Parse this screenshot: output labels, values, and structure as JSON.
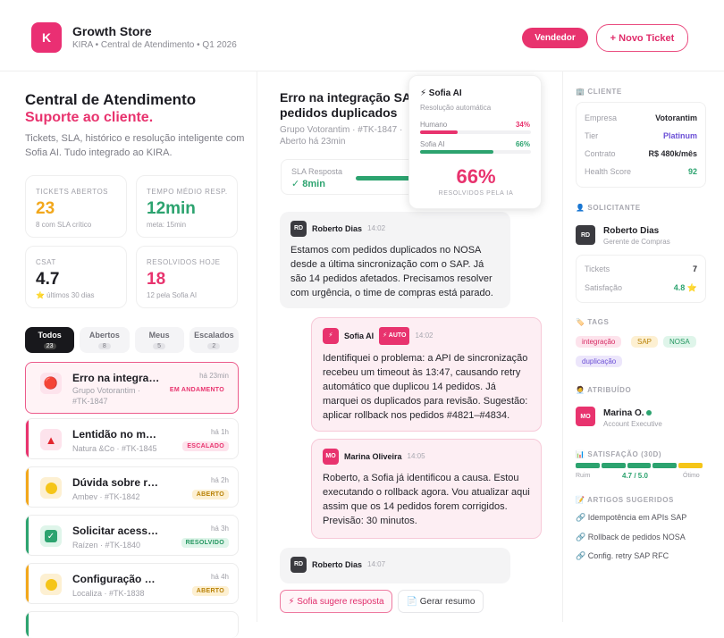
{
  "app": {
    "logo_letter": "K",
    "title": "Growth Store",
    "subtitle": "KIRA • Central de Atendimento • Q1 2026",
    "role_button": "Vendedor",
    "new_ticket_button": "+ Novo Ticket"
  },
  "left": {
    "title": "Central de Atendimento",
    "subtitle": "Suporte ao cliente.",
    "description": "Tickets, SLA, histórico e resolução inteligente com Sofia AI. Tudo integrado ao KIRA.",
    "stats": [
      {
        "label": "TICKETS ABERTOS",
        "value": "23",
        "note": "8 com SLA crítico",
        "color": "#f2a71b"
      },
      {
        "label": "TEMPO MÉDIO RESP.",
        "value": "12min",
        "note": "meta: 15min",
        "color": "#2ca36f"
      },
      {
        "label": "CSAT",
        "value": "4.7",
        "note": "⭐ últimos 30 dias",
        "color": "#1c1c22"
      },
      {
        "label": "RESOLVIDOS HOJE",
        "value": "18",
        "note": "12 pela Sofia AI",
        "color": "#e8336e"
      }
    ],
    "tabs": [
      {
        "label": "Todos",
        "count": "23"
      },
      {
        "label": "Abertos",
        "count": "8"
      },
      {
        "label": "Meus",
        "count": "5"
      },
      {
        "label": "Escalados",
        "count": "2"
      }
    ],
    "tickets": [
      {
        "title": "Erro na integraç…",
        "company": "Grupo Votorantim · #TK-1847",
        "company_line1": "Grupo Votorantim ·",
        "company_line2": "#TK-1847",
        "time": "há 23min",
        "status": "EM ANDAMENTO",
        "icon": "🔴",
        "icon_name": "red-circle-icon"
      },
      {
        "title": "Lentidão no módulo …",
        "company": "Natura &Co · #TK-1845",
        "time": "há 1h",
        "status": "ESCALADO",
        "icon": "🔺",
        "icon_name": "red-triangle-icon"
      },
      {
        "title": "Dúvida sobre relatório …",
        "company": "Ambev · #TK-1842",
        "time": "há 2h",
        "status": "ABERTO",
        "icon": "🟡",
        "icon_name": "yellow-circle-icon"
      },
      {
        "title": "Solicitar acesso nov…",
        "company": "Raízen · #TK-1840",
        "time": "há 3h",
        "status": "RESOLVIDO",
        "icon": "✅",
        "icon_name": "check-mark-icon"
      },
      {
        "title": "Configuração de work…",
        "company": "Localiza · #TK-1838",
        "time": "há 4h",
        "status": "ABERTO",
        "icon": "🟡",
        "icon_name": "yellow-circle-icon"
      }
    ]
  },
  "middle": {
    "title_line1": "Erro na integração SA",
    "title_line2": "pedidos duplicados",
    "meta_line1": "Grupo Votorantim · #TK-1847 ·",
    "meta_line2": "Aberto há 23min",
    "sla_label": "SLA Resposta",
    "sla_value": "✓ 8min",
    "sla_progress": 0.55,
    "sofia_popup": {
      "title": "⚡ Sofia AI",
      "subtitle": "Resolução automática",
      "rows": [
        {
          "label": "Humano",
          "value": "34%",
          "pct": 0.34,
          "color": "#e8336e"
        },
        {
          "label": "Sofia AI",
          "value": "66%",
          "pct": 0.66,
          "color": "#2ca36f"
        }
      ],
      "big_value": "66%",
      "big_label": "RESOLVIDOS PELA IA"
    },
    "messages": [
      {
        "initials": "RD",
        "name": "Roberto Dias",
        "time": "14:02",
        "text": "Estamos com pedidos duplicados no NOSA desde a última sincronização com o SAP. Já são 14 pedidos afetados. Precisamos resolver com urgência, o time de compras está parado."
      },
      {
        "initials": "⚡",
        "name": "Sofia AI",
        "tag": "⚡ AUTO",
        "time": "14:02",
        "text": "Identifiquei o problema: a API de sincronização recebeu um timeout às 13:47, causando retry automático que duplicou 14 pedidos. Já marquei os duplicados para revisão. Sugestão: aplicar rollback nos pedidos #4821–#4834."
      },
      {
        "initials": "MO",
        "name": "Marina Oliveira",
        "time": "14:05",
        "text": "Roberto, a Sofia já identificou a causa. Estou executando o rollback agora. Vou atualizar aqui assim que os 14 pedidos forem corrigidos. Previsão: 30 minutos."
      },
      {
        "initials": "RD",
        "name": "Roberto Dias",
        "time": "14:07",
        "text": ""
      }
    ],
    "suggest_button": "⚡ Sofia sugere resposta",
    "summary_button": "📄 Gerar resumo"
  },
  "right": {
    "client_section": "🏢 CLIENTE",
    "client": [
      {
        "k": "Empresa",
        "v": "Votorantim",
        "color": "#2a2a30"
      },
      {
        "k": "Tier",
        "v": "Platinum",
        "color": "#6b4fd6"
      },
      {
        "k": "Contrato",
        "v": "R$ 480k/mês",
        "color": "#2a2a30"
      },
      {
        "k": "Health Score",
        "v": "92",
        "color": "#2ca36f"
      }
    ],
    "requester_section": "👤 SOLICITANTE",
    "requester": {
      "initials": "RD",
      "name": "Roberto Dias",
      "role": "Gerente de Compras"
    },
    "requester_kv": [
      {
        "k": "Tickets",
        "v": "7",
        "color": "#2a2a30"
      },
      {
        "k": "Satisfação",
        "v": "4.8 ⭐",
        "color": "#2ca36f"
      }
    ],
    "tags_section": "🏷️ TAGS",
    "tags": [
      {
        "label": "integração",
        "bg": "#fde3ec",
        "fg": "#d62b63"
      },
      {
        "label": "SAP",
        "bg": "#fdf0d2",
        "fg": "#b98207"
      },
      {
        "label": "NOSA",
        "bg": "#dff5ea",
        "fg": "#23965f"
      },
      {
        "label": "duplicação",
        "bg": "#ece6fb",
        "fg": "#6b4fd6"
      }
    ],
    "assigned_section": "🧑‍💼 ATRIBUÍDO",
    "assigned": {
      "initials": "MO",
      "name": "Marina O.",
      "role": "Account Executive"
    },
    "satisfaction_section": "📊 SATISFAÇÃO (30D)",
    "satisfaction": {
      "low": "Ruim",
      "value": "4.7 / 5.0",
      "high": "Ótimo",
      "score": 4.7
    },
    "articles_section": "📝 ARTIGOS SUGERIDOS",
    "articles": [
      "🔗 Idempotência em APIs SAP",
      "🔗 Rollback de pedidos NOSA",
      "🔗 Config. retry SAP RFC"
    ]
  }
}
